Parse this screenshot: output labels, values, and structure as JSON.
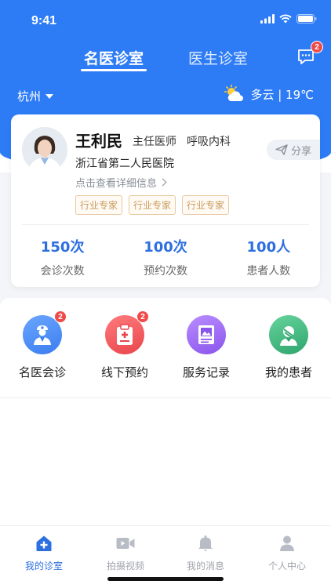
{
  "status": {
    "time": "9:41"
  },
  "tabs": [
    {
      "label": "名医诊室",
      "active": true
    },
    {
      "label": "医生诊室",
      "active": false
    }
  ],
  "messages": {
    "badge": "2",
    "icon": "chat-bubble-icon"
  },
  "location": {
    "city": "杭州"
  },
  "weather": {
    "text": "多云 | 19℃",
    "icon": "partly-cloudy-icon"
  },
  "doctor": {
    "name": "王利民",
    "title": "主任医师",
    "department": "呼吸内科",
    "hospital": "浙江省第二人民医院",
    "detail_link": "点击查看详细信息",
    "share_label": "分享",
    "tags": [
      "行业专家",
      "行业专家",
      "行业专家"
    ],
    "stats": [
      {
        "value": "150次",
        "label": "会诊次数"
      },
      {
        "value": "100次",
        "label": "预约次数"
      },
      {
        "value": "100人",
        "label": "患者人数"
      }
    ]
  },
  "functions": [
    {
      "label": "名医会诊",
      "badge": "2",
      "color": "#4b8ef5",
      "icon": "doctor-icon"
    },
    {
      "label": "线下预约",
      "badge": "2",
      "color": "#f0585c",
      "icon": "clipboard-icon"
    },
    {
      "label": "服务记录",
      "badge": "",
      "color": "#9c6cf0",
      "icon": "records-icon"
    },
    {
      "label": "我的患者",
      "badge": "",
      "color": "#3fb57f",
      "icon": "patient-icon"
    }
  ],
  "bottom_nav": [
    {
      "label": "我的诊室",
      "active": true,
      "icon": "home-plus-icon"
    },
    {
      "label": "拍摄视频",
      "active": false,
      "icon": "video-camera-icon"
    },
    {
      "label": "我的消息",
      "active": false,
      "icon": "bell-icon"
    },
    {
      "label": "个人中心",
      "active": false,
      "icon": "user-icon"
    }
  ],
  "colors": {
    "primary": "#2d7cf6",
    "accent_text": "#2d6fe0",
    "badge": "#f04b4b",
    "tag": "#c89b5e"
  }
}
